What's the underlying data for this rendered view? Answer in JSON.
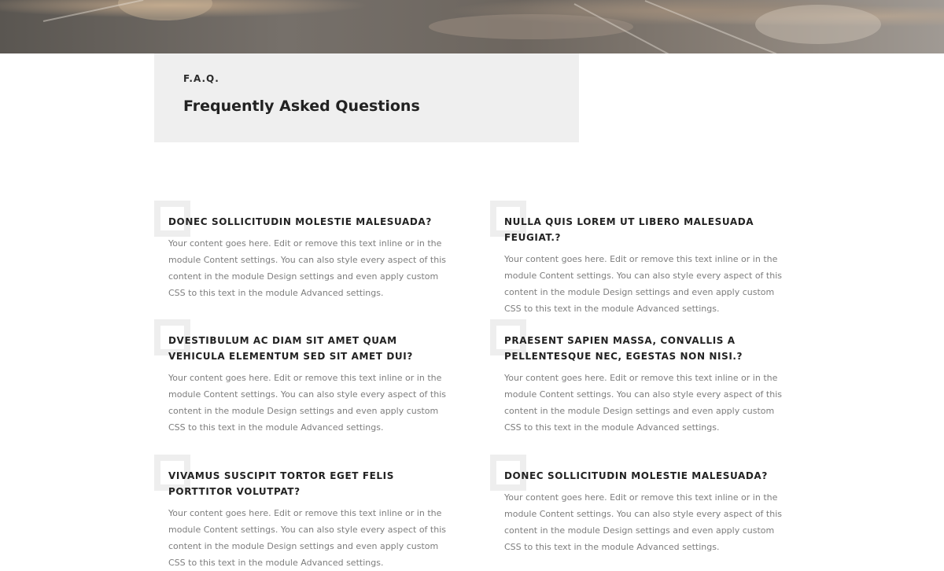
{
  "colors": {
    "header_box": "#efefef",
    "quote_mark": "#eeeeee",
    "heading": "#222222",
    "body_text": "#7d7d7d"
  },
  "header": {
    "label": "F.A.Q.",
    "title": "Frequently Asked Questions"
  },
  "faq_items": [
    {
      "question": "DONEC SOLLICITUDIN MOLESTIE MALESUADA?",
      "answer": "Your content goes here. Edit or remove this text inline or in the module Content settings. You can also style every aspect of this content in the module Design settings and even apply custom CSS to this text in the module Advanced settings."
    },
    {
      "question": "NULLA QUIS LOREM UT LIBERO MALESUADA FEUGIAT.?",
      "answer": "Your content goes here. Edit or remove this text inline or in the module Content settings. You can also style every aspect of this content in the module Design settings and even apply custom CSS to this text in the module Advanced settings."
    },
    {
      "question": "DVESTIBULUM AC DIAM SIT AMET QUAM VEHICULA ELEMENTUM SED SIT AMET DUI?",
      "answer": "Your content goes here. Edit or remove this text inline or in the module Content settings. You can also style every aspect of this content in the module Design settings and even apply custom CSS to this text in the module Advanced settings."
    },
    {
      "question": "PRAESENT SAPIEN MASSA, CONVALLIS A PELLENTESQUE NEC, EGESTAS NON NISI.?",
      "answer": "Your content goes here. Edit or remove this text inline or in the module Content settings. You can also style every aspect of this content in the module Design settings and even apply custom CSS to this text in the module Advanced settings."
    },
    {
      "question": "VIVAMUS SUSCIPIT TORTOR EGET FELIS PORTTITOR VOLUTPAT?",
      "answer": "Your content goes here. Edit or remove this text inline or in the module Content settings. You can also style every aspect of this content in the module Design settings and even apply custom CSS to this text in the module Advanced settings."
    },
    {
      "question": "DONEC SOLLICITUDIN MOLESTIE MALESUADA?",
      "answer": "Your content goes here. Edit or remove this text inline or in the module Content settings. You can also style every aspect of this content in the module Design settings and even apply custom CSS to this text in the module Advanced settings."
    }
  ]
}
